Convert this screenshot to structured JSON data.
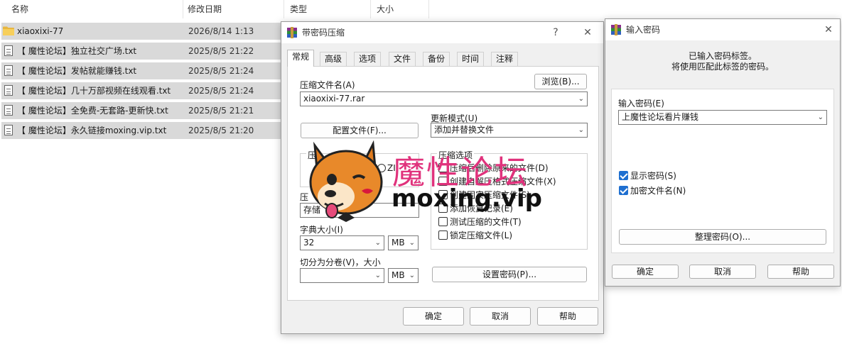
{
  "explorer": {
    "columns": {
      "name": "名称",
      "date": "修改日期",
      "type": "类型",
      "size": "大小"
    },
    "files": [
      {
        "name": "xiaoxixi-77",
        "date": "2026/8/14 1:13",
        "kind": "folder"
      },
      {
        "name": "【 魔性论坛】独立社交广场.txt",
        "date": "2025/8/5 21:22",
        "kind": "txt"
      },
      {
        "name": "【 魔性论坛】发帖就能赚钱.txt",
        "date": "2025/8/5 21:24",
        "kind": "txt"
      },
      {
        "name": "【 魔性论坛】几十万部视频在线观看.txt",
        "date": "2025/8/5 21:24",
        "kind": "txt"
      },
      {
        "name": "【 魔性论坛】全免费-无套路-更新快.txt",
        "date": "2025/8/5 21:21",
        "kind": "txt"
      },
      {
        "name": "【 魔性论坛】永久链接moxing.vip.txt",
        "date": "2025/8/5 21:20",
        "kind": "txt"
      }
    ]
  },
  "rar_dialog": {
    "title": "带密码压缩",
    "help_glyph": "?",
    "close_glyph": "✕",
    "tabs": [
      "常规",
      "高级",
      "选项",
      "文件",
      "备份",
      "时间",
      "注释"
    ],
    "archive_name_label": "压缩文件名(A)",
    "browse_button": "浏览(B)...",
    "archive_name_value": "xiaoxixi-77.rar",
    "update_mode_label": "更新模式(U)",
    "profiles_button": "配置文件(F)...",
    "update_mode_value": "添加并替换文件",
    "format_label_partial": "压",
    "format_zip_partial": "ZI",
    "method_label_partial": "压",
    "method_value_partial": "存储",
    "dict_size_label": "字典大小(I)",
    "dict_size_value": "32",
    "dict_unit": "MB",
    "split_label": "切分为分卷(V)，大小",
    "split_value": "",
    "split_unit": "MB",
    "options_title": "压缩选项",
    "options": [
      {
        "label": "压缩后删除原来的文件(D)",
        "checked": false
      },
      {
        "label": "创建自解压格式压缩文件(X)",
        "checked": false
      },
      {
        "label": "创建固实压缩文件(S)",
        "checked": false
      },
      {
        "label": "添加恢复记录(E)",
        "checked": false
      },
      {
        "label": "测试压缩的文件(T)",
        "checked": false
      },
      {
        "label": "锁定压缩文件(L)",
        "checked": false
      }
    ],
    "set_password_button": "设置密码(P)...",
    "ok_button": "确定",
    "cancel_button": "取消",
    "help_button": "帮助"
  },
  "pwd_dialog": {
    "title": "输入密码",
    "close_glyph": "✕",
    "info_line1": "已输入密码标签。",
    "info_line2": "将使用匹配此标签的密码。",
    "password_label": "输入密码(E)",
    "password_value": "上魔性论坛看片赚钱",
    "show_password_label": "显示密码(S)",
    "show_password_checked": true,
    "encrypt_names_label": "加密文件名(N)",
    "encrypt_names_checked": true,
    "organize_button": "整理密码(O)...",
    "ok_button": "确定",
    "cancel_button": "取消",
    "help_button": "帮助"
  },
  "watermark": {
    "cn": "魔性论坛",
    "en": "moxing.vip"
  },
  "colors": {
    "selection": "#d9d9d9",
    "dialog_bg": "#f0f0f0",
    "checkbox_blue": "#1e6fd0",
    "watermark_pink": "#e0327c"
  }
}
